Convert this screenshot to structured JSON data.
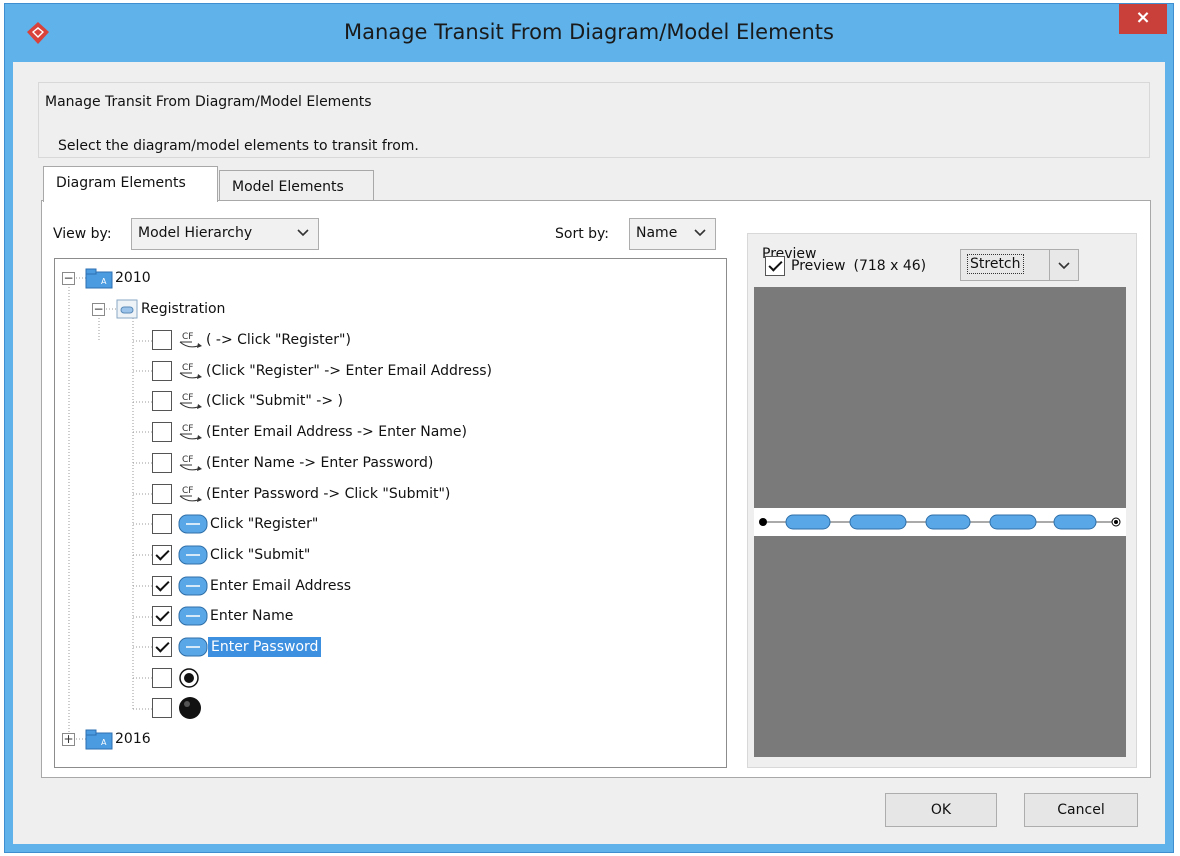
{
  "window": {
    "title": "Manage Transit From Diagram/Model Elements",
    "close_label": "×"
  },
  "header": {
    "title": "Manage Transit From Diagram/Model Elements",
    "subtitle": "Select the diagram/model elements to transit from."
  },
  "tabs": [
    {
      "label": "Diagram Elements",
      "active": true
    },
    {
      "label": "Model Elements",
      "active": false
    }
  ],
  "view_by": {
    "label": "View by:",
    "value": "Model Hierarchy"
  },
  "sort_by": {
    "label": "Sort by:",
    "value": "Name"
  },
  "tree": {
    "root1": {
      "label": "2010",
      "expanded": true
    },
    "diagram": {
      "label": "Registration",
      "expanded": true
    },
    "items": [
      {
        "label": "( -> Click \"Register\")",
        "type": "control-flow",
        "checked": false,
        "selected": false
      },
      {
        "label": "(Click \"Register\" -> Enter Email Address)",
        "type": "control-flow",
        "checked": false,
        "selected": false
      },
      {
        "label": "(Click \"Submit\" -> )",
        "type": "control-flow",
        "checked": false,
        "selected": false
      },
      {
        "label": "(Enter Email Address -> Enter Name)",
        "type": "control-flow",
        "checked": false,
        "selected": false
      },
      {
        "label": "(Enter Name -> Enter Password)",
        "type": "control-flow",
        "checked": false,
        "selected": false
      },
      {
        "label": "(Enter Password -> Click \"Submit\")",
        "type": "control-flow",
        "checked": false,
        "selected": false
      },
      {
        "label": "Click \"Register\"",
        "type": "action",
        "checked": false,
        "selected": false
      },
      {
        "label": "Click \"Submit\"",
        "type": "action",
        "checked": true,
        "selected": false
      },
      {
        "label": "Enter Email Address",
        "type": "action",
        "checked": true,
        "selected": false
      },
      {
        "label": "Enter Name",
        "type": "action",
        "checked": true,
        "selected": false
      },
      {
        "label": "Enter Password",
        "type": "action",
        "checked": true,
        "selected": true
      },
      {
        "label": "",
        "type": "final-node",
        "checked": false,
        "selected": false
      },
      {
        "label": "",
        "type": "initial-node",
        "checked": false,
        "selected": false
      }
    ],
    "root2": {
      "label": "2016",
      "expanded": false
    },
    "flow_icon_text": "CF"
  },
  "preview": {
    "legend": "Preview",
    "checkbox_label": "Preview",
    "checked": true,
    "size_text": "(718 x 46)",
    "mode": "Stretch"
  },
  "buttons": {
    "ok": "OK",
    "cancel": "Cancel"
  },
  "colors": {
    "title_bar": "#5fb2ea",
    "close": "#c9403a",
    "selection": "#3d8fe0",
    "preview_bg": "#7a7a7a",
    "action_node": "#5aa7e8"
  }
}
